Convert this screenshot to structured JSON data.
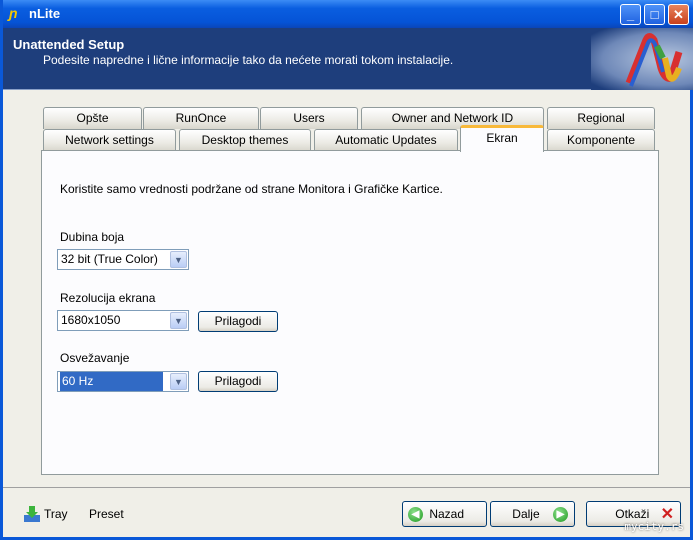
{
  "window": {
    "title": "nLite",
    "minimize": "_",
    "maximize": "□",
    "close": "✕"
  },
  "header": {
    "title": "Unattended Setup",
    "subtitle": "Podesite napredne i lične informacije tako da nećete morati tokom instalacije."
  },
  "tabs_row1": [
    "Opšte",
    "RunOnce",
    "Users",
    "Owner and Network ID",
    "Regional"
  ],
  "tabs_row2": [
    "Network settings",
    "Desktop themes",
    "Automatic Updates",
    "Ekran",
    "Komponente"
  ],
  "active_tab": "Ekran",
  "panel": {
    "info": "Koristite samo vrednosti podržane od strane Monitora i Grafičke Kartice.",
    "color_depth": {
      "label": "Dubina boja",
      "value": "32 bit (True Color)"
    },
    "resolution": {
      "label": "Rezolucija ekrana",
      "value": "1680x1050",
      "button": "Prilagodi"
    },
    "refresh": {
      "label": "Osvežavanje",
      "value": "60 Hz",
      "button": "Prilagodi"
    }
  },
  "footer": {
    "tray": "Tray",
    "preset": "Preset",
    "back": "Nazad",
    "next": "Dalje",
    "cancel": "Otkaži"
  },
  "watermark": "mycity.rs"
}
